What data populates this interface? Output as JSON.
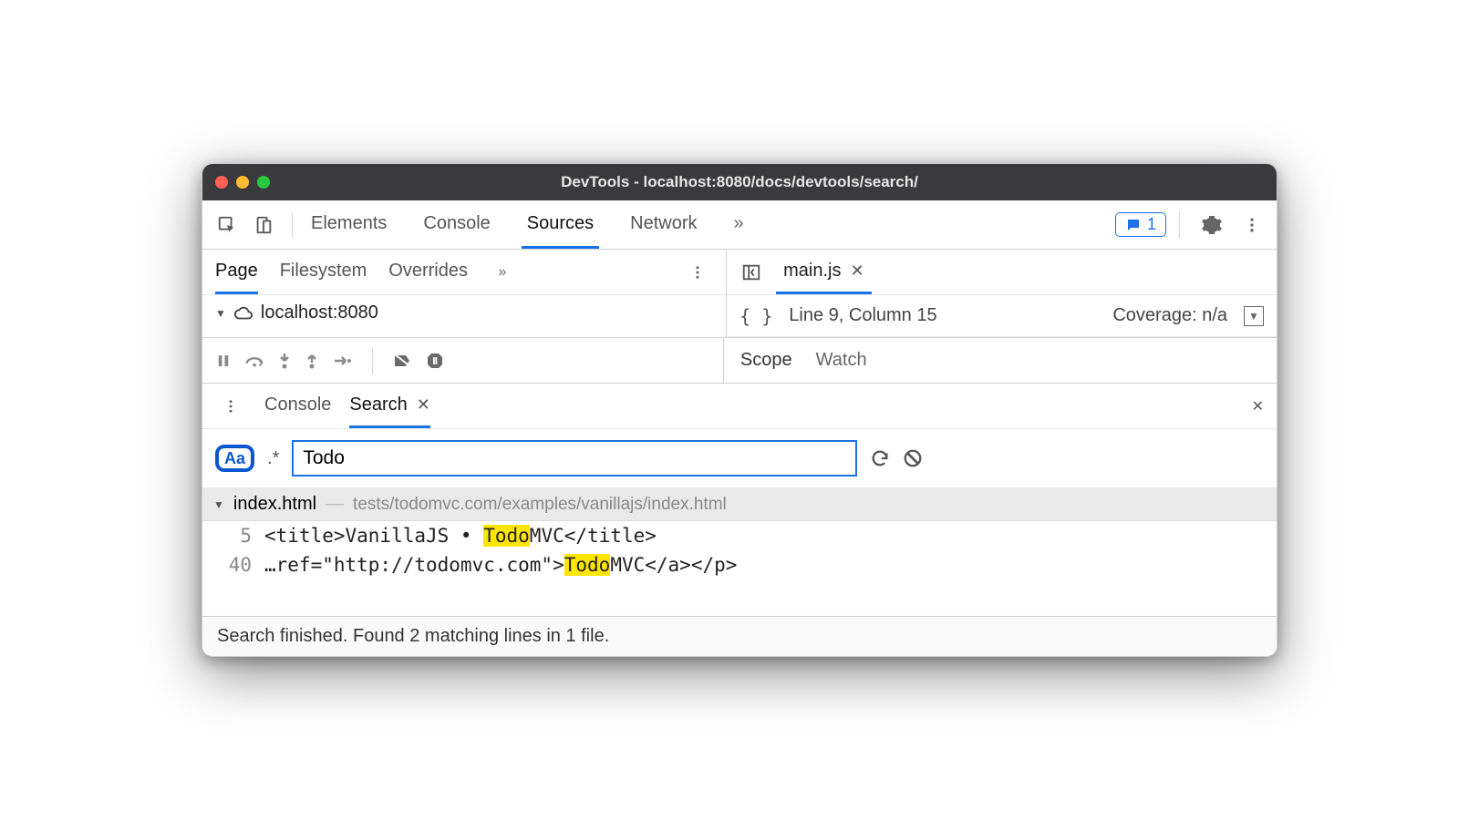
{
  "window": {
    "title": "DevTools - localhost:8080/docs/devtools/search/"
  },
  "main_tabs": {
    "elements": "Elements",
    "console": "Console",
    "sources": "Sources",
    "network": "Network"
  },
  "feedback_count": "1",
  "sources_subtabs": {
    "page": "Page",
    "filesystem": "Filesystem",
    "overrides": "Overrides"
  },
  "tree": {
    "host": "localhost:8080"
  },
  "editor": {
    "tab_name": "main.js",
    "cursor": "Line 9, Column 15",
    "coverage": "Coverage: n/a"
  },
  "debugger_right": {
    "scope": "Scope",
    "watch": "Watch"
  },
  "drawer": {
    "console": "Console",
    "search": "Search"
  },
  "search": {
    "case_label": "Aa",
    "regex_label": ".*",
    "query": "Todo"
  },
  "results": {
    "file_name": "index.html",
    "file_path": "tests/todomvc.com/examples/vanillajs/index.html",
    "lines": [
      {
        "no": "5",
        "pre": "<title>VanillaJS • ",
        "hl": "Todo",
        "post": "MVC</title>"
      },
      {
        "no": "40",
        "pre": "…ref=\"http://todomvc.com\">",
        "hl": "Todo",
        "post": "MVC</a></p>"
      }
    ]
  },
  "status": "Search finished.  Found 2 matching lines in 1 file."
}
